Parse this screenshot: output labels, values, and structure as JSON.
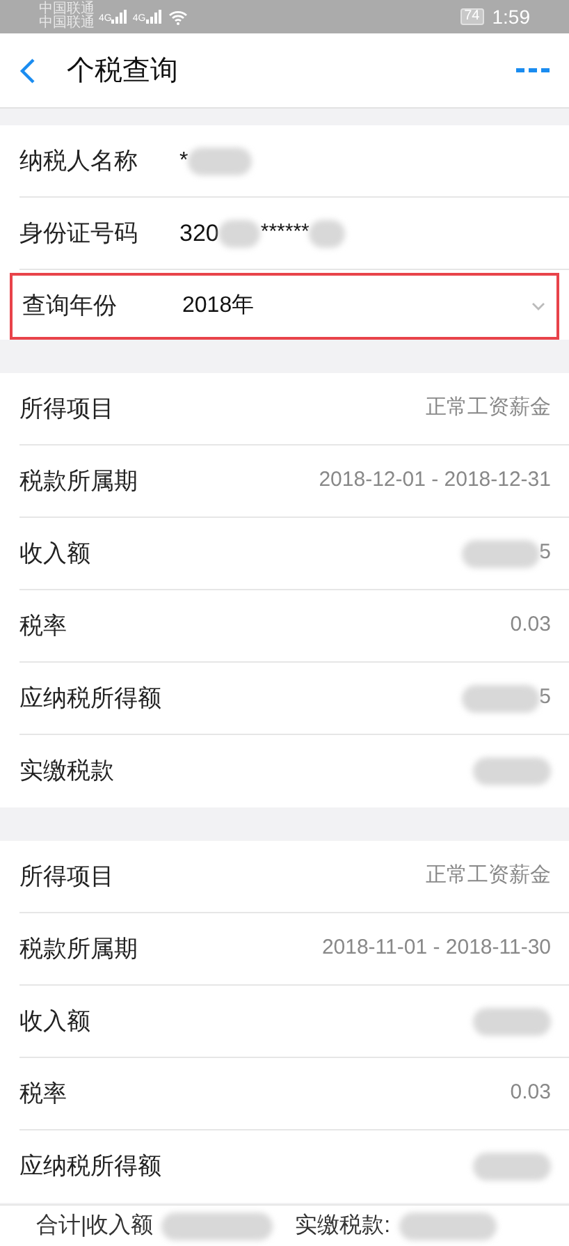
{
  "status_bar": {
    "carriers": [
      "中国联通",
      "中国联通"
    ],
    "network_labels": [
      "4G",
      "4G"
    ],
    "battery": "74",
    "time": "1:59"
  },
  "header": {
    "title": "个税查询"
  },
  "taxpayer": [
    {
      "label": "纳税人名称",
      "kind": "masked",
      "value": "*"
    },
    {
      "label": "身份证号码",
      "kind": "id",
      "value_parts": [
        "320",
        "******"
      ]
    },
    {
      "label": "查询年份",
      "kind": "select",
      "value": "2018年",
      "highlighted": true
    }
  ],
  "records": [
    {
      "rows": [
        {
          "label": "所得项目",
          "value": "正常工资薪金"
        },
        {
          "label": "税款所属期",
          "value": "2018-12-01 - 2018-12-31"
        },
        {
          "label": "收入额",
          "value": "5",
          "blurred": true
        },
        {
          "label": "税率",
          "value": "0.03"
        },
        {
          "label": "应纳税所得额",
          "value": "5",
          "blurred": true
        },
        {
          "label": "实缴税款",
          "blurred": true
        }
      ]
    },
    {
      "rows": [
        {
          "label": "所得项目",
          "value": "正常工资薪金"
        },
        {
          "label": "税款所属期",
          "value": "2018-11-01 - 2018-11-30"
        },
        {
          "label": "收入额",
          "blurred": true
        },
        {
          "label": "税率",
          "value": "0.03"
        },
        {
          "label": "应纳税所得额",
          "blurred": true
        }
      ]
    }
  ],
  "footer": {
    "total_income_label": "合计|收入额",
    "total_tax_label": "实缴税款:"
  }
}
